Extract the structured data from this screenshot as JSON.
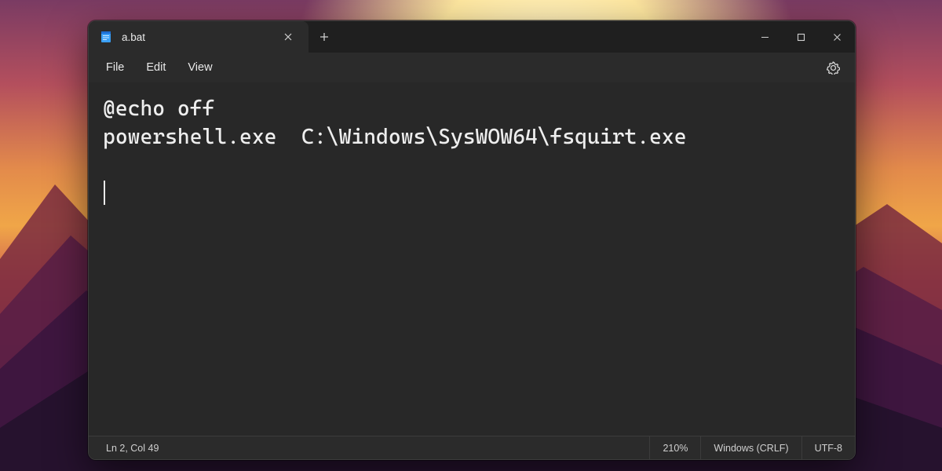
{
  "tab": {
    "title": "a.bat"
  },
  "menus": {
    "file": "File",
    "edit": "Edit",
    "view": "View"
  },
  "editor": {
    "lines": [
      "@echo off",
      "powershell.exe  C:\\Windows\\SysWOW64\\fsquirt.exe"
    ]
  },
  "statusbar": {
    "position": "Ln 2, Col 49",
    "zoom": "210%",
    "line_endings": "Windows (CRLF)",
    "encoding": "UTF-8"
  }
}
